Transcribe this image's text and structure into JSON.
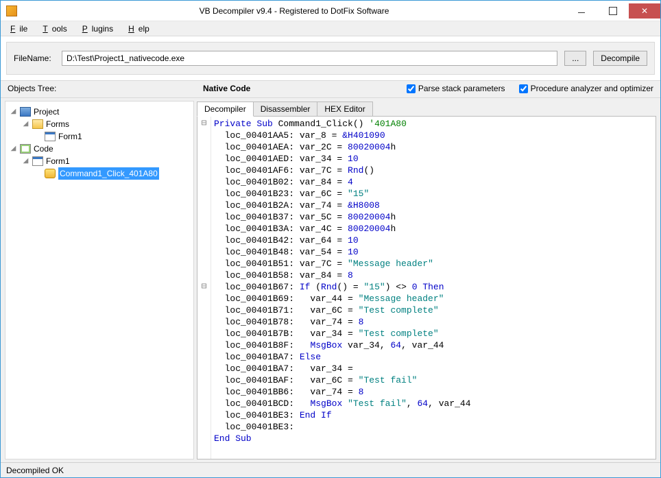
{
  "window": {
    "title": "VB Decompiler v9.4 - Registered to DotFix Software"
  },
  "menu": {
    "file": "File",
    "tools": "Tools",
    "plugins": "Plugins",
    "help": "Help"
  },
  "filepanel": {
    "label": "FileName:",
    "value": "D:\\Test\\Project1_nativecode.exe",
    "browse": "...",
    "decompile": "Decompile"
  },
  "options": {
    "objects_tree_label": "Objects Tree:",
    "native_code_label": "Native Code",
    "parse_stack_label": "Parse stack parameters",
    "parse_stack_checked": true,
    "proc_analyzer_label": "Procedure analyzer and optimizer",
    "proc_analyzer_checked": true
  },
  "tree": {
    "project": "Project",
    "forms": "Forms",
    "form1_folder": "Form1",
    "code": "Code",
    "form1_code": "Form1",
    "proc": "Command1_Click_401A80"
  },
  "tabs": {
    "decompiler": "Decompiler",
    "disassembler": "Disassembler",
    "hex": "HEX Editor"
  },
  "code": [
    {
      "t": [
        {
          "c": "kw",
          "s": "Private Sub"
        },
        {
          "s": " Command1_Click() "
        },
        {
          "c": "cmt",
          "s": "'401A80"
        }
      ]
    },
    {
      "t": [
        {
          "s": "  loc_00401AA5: var_8 = "
        },
        {
          "c": "num",
          "s": "&H401090"
        }
      ]
    },
    {
      "t": [
        {
          "s": "  loc_00401AEA: var_2C = "
        },
        {
          "c": "num",
          "s": "80020004"
        },
        {
          "s": "h"
        }
      ]
    },
    {
      "t": [
        {
          "s": "  loc_00401AED: var_34 = "
        },
        {
          "c": "num",
          "s": "10"
        }
      ]
    },
    {
      "t": [
        {
          "s": "  loc_00401AF6: var_7C = "
        },
        {
          "c": "kw",
          "s": "Rnd"
        },
        {
          "s": "()"
        }
      ]
    },
    {
      "t": [
        {
          "s": "  loc_00401B02: var_84 = "
        },
        {
          "c": "num",
          "s": "4"
        }
      ]
    },
    {
      "t": [
        {
          "s": "  loc_00401B23: var_6C = "
        },
        {
          "c": "str",
          "s": "\"15\""
        }
      ]
    },
    {
      "t": [
        {
          "s": "  loc_00401B2A: var_74 = "
        },
        {
          "c": "num",
          "s": "&H8008"
        }
      ]
    },
    {
      "t": [
        {
          "s": "  loc_00401B37: var_5C = "
        },
        {
          "c": "num",
          "s": "80020004"
        },
        {
          "s": "h"
        }
      ]
    },
    {
      "t": [
        {
          "s": "  loc_00401B3A: var_4C = "
        },
        {
          "c": "num",
          "s": "80020004"
        },
        {
          "s": "h"
        }
      ]
    },
    {
      "t": [
        {
          "s": "  loc_00401B42: var_64 = "
        },
        {
          "c": "num",
          "s": "10"
        }
      ]
    },
    {
      "t": [
        {
          "s": "  loc_00401B48: var_54 = "
        },
        {
          "c": "num",
          "s": "10"
        }
      ]
    },
    {
      "t": [
        {
          "s": "  loc_00401B51: var_7C = "
        },
        {
          "c": "str",
          "s": "\"Message header\""
        }
      ]
    },
    {
      "t": [
        {
          "s": "  loc_00401B58: var_84 = "
        },
        {
          "c": "num",
          "s": "8"
        }
      ]
    },
    {
      "t": [
        {
          "s": "  loc_00401B67: "
        },
        {
          "c": "kw",
          "s": "If"
        },
        {
          "s": " ("
        },
        {
          "c": "kw",
          "s": "Rnd"
        },
        {
          "s": "() = "
        },
        {
          "c": "str",
          "s": "\"15\""
        },
        {
          "s": ") <> "
        },
        {
          "c": "num",
          "s": "0"
        },
        {
          "s": " "
        },
        {
          "c": "kw",
          "s": "Then"
        }
      ]
    },
    {
      "t": [
        {
          "s": "  loc_00401B69:   var_44 = "
        },
        {
          "c": "str",
          "s": "\"Message header\""
        }
      ]
    },
    {
      "t": [
        {
          "s": "  loc_00401B71:   var_6C = "
        },
        {
          "c": "str",
          "s": "\"Test complete\""
        }
      ]
    },
    {
      "t": [
        {
          "s": "  loc_00401B78:   var_74 = "
        },
        {
          "c": "num",
          "s": "8"
        }
      ]
    },
    {
      "t": [
        {
          "s": "  loc_00401B7B:   var_34 = "
        },
        {
          "c": "str",
          "s": "\"Test complete\""
        }
      ]
    },
    {
      "t": [
        {
          "s": "  loc_00401B8F:   "
        },
        {
          "c": "kw",
          "s": "MsgBox"
        },
        {
          "s": " var_34, "
        },
        {
          "c": "num",
          "s": "64"
        },
        {
          "s": ", var_44"
        }
      ]
    },
    {
      "t": [
        {
          "s": "  loc_00401BA7: "
        },
        {
          "c": "kw",
          "s": "Else"
        }
      ]
    },
    {
      "t": [
        {
          "s": "  loc_00401BA7:   var_34 ="
        }
      ]
    },
    {
      "t": [
        {
          "s": "  loc_00401BAF:   var_6C = "
        },
        {
          "c": "str",
          "s": "\"Test fail\""
        }
      ]
    },
    {
      "t": [
        {
          "s": "  loc_00401BB6:   var_74 = "
        },
        {
          "c": "num",
          "s": "8"
        }
      ]
    },
    {
      "t": [
        {
          "s": "  loc_00401BCD:   "
        },
        {
          "c": "kw",
          "s": "MsgBox"
        },
        {
          "s": " "
        },
        {
          "c": "str",
          "s": "\"Test fail\""
        },
        {
          "s": ", "
        },
        {
          "c": "num",
          "s": "64"
        },
        {
          "s": ", var_44"
        }
      ]
    },
    {
      "t": [
        {
          "s": "  loc_00401BE3: "
        },
        {
          "c": "kw",
          "s": "End If"
        }
      ]
    },
    {
      "t": [
        {
          "s": "  loc_00401BE3:"
        }
      ]
    },
    {
      "t": [
        {
          "c": "kw",
          "s": "End Sub"
        }
      ]
    }
  ],
  "gutter_collapse_lines": [
    0,
    14
  ],
  "status": "Decompiled OK"
}
